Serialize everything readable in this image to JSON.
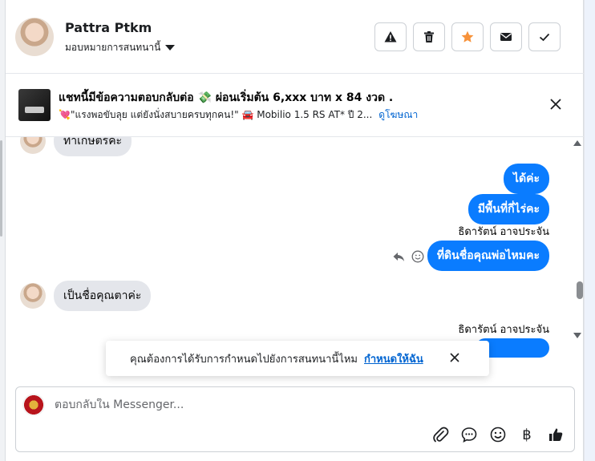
{
  "header": {
    "name": "Pattra Ptkm",
    "assign_label": "มอบหมายการสนทนานี้"
  },
  "ad": {
    "title": "แชทนี้มีข้อความตอบกลับต่อ 💸 ผ่อนเริ่มต้น 6,xxx บาท x 84 งวด .",
    "subtitle": "💘\"แรงพอขับลุย แต่ยังนั่งสบายครบทุกคน!\" 🚘 Mobilio 1.5 RS AT* ปี 2...",
    "link": "ดูโฆษณา"
  },
  "messages": {
    "incoming_top": "ทำเกษตรค่ะ",
    "out_1": "ได้ค่ะ",
    "out_2": "มีพื้นที่กี่ไร่คะ",
    "sender_1": "ธิดารัตน์ อาจประจัน",
    "out_3": "ที่ดินชื่อคุณพ่อไหมคะ",
    "incoming_2": "เป็นชื่อคุณตาค่ะ",
    "sender_2": "ธิดารัตน์ อาจประจัน"
  },
  "toast": {
    "text": "คุณต้องการได้รับการกำหนดไปยังการสนทนานี้ไหม",
    "link": "กำหนดให้ฉัน"
  },
  "composer": {
    "placeholder": "ตอบกลับใน Messenger..."
  },
  "colors": {
    "accent_blue": "#0a7cff",
    "star": "#f7923a"
  }
}
